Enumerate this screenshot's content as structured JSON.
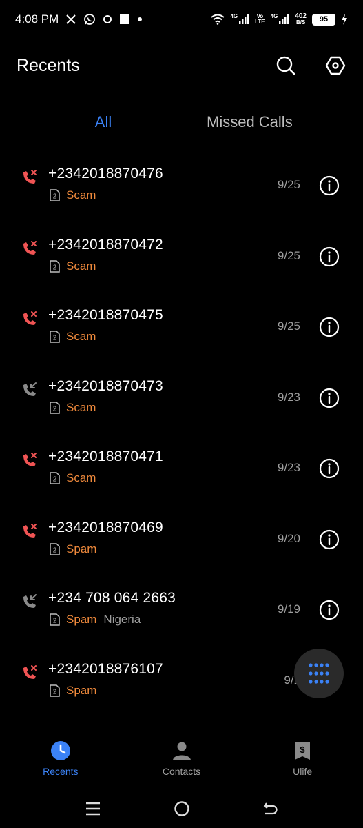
{
  "status_bar": {
    "time": "4:08 PM",
    "network_1": "4G",
    "volte_top": "Vo",
    "volte_bottom": "LTE",
    "network_2": "4G",
    "data_rate_value": "402",
    "data_rate_unit": "B/S",
    "battery": "95"
  },
  "header": {
    "title": "Recents"
  },
  "tabs": [
    {
      "label": "All",
      "active": true
    },
    {
      "label": "Missed Calls",
      "active": false
    }
  ],
  "calls": [
    {
      "number": "+2342018870476",
      "label": "Scam",
      "location": "",
      "date": "9/25",
      "type": "missed"
    },
    {
      "number": "+2342018870472",
      "label": "Scam",
      "location": "",
      "date": "9/25",
      "type": "missed"
    },
    {
      "number": "+2342018870475",
      "label": "Scam",
      "location": "",
      "date": "9/25",
      "type": "missed"
    },
    {
      "number": "+2342018870473",
      "label": "Scam",
      "location": "",
      "date": "9/23",
      "type": "incoming"
    },
    {
      "number": "+2342018870471",
      "label": "Scam",
      "location": "",
      "date": "9/23",
      "type": "missed"
    },
    {
      "number": "+2342018870469",
      "label": "Spam",
      "location": "",
      "date": "9/20",
      "type": "missed"
    },
    {
      "number": "+234 708 064 2663",
      "label": "Spam",
      "location": "Nigeria",
      "date": "9/19",
      "type": "incoming"
    },
    {
      "number": "+2342018876107",
      "label": "Spam",
      "location": "",
      "date": "9/1",
      "type": "missed"
    }
  ],
  "bottom_nav": [
    {
      "label": "Recents",
      "icon": "clock-icon",
      "active": true
    },
    {
      "label": "Contacts",
      "icon": "person-icon",
      "active": false
    },
    {
      "label": "Ulife",
      "icon": "wallet-icon",
      "active": false
    }
  ],
  "colors": {
    "accent": "#3b82f6",
    "missed": "#f05454",
    "label": "#f08a3c",
    "muted": "#9e9e9e"
  }
}
